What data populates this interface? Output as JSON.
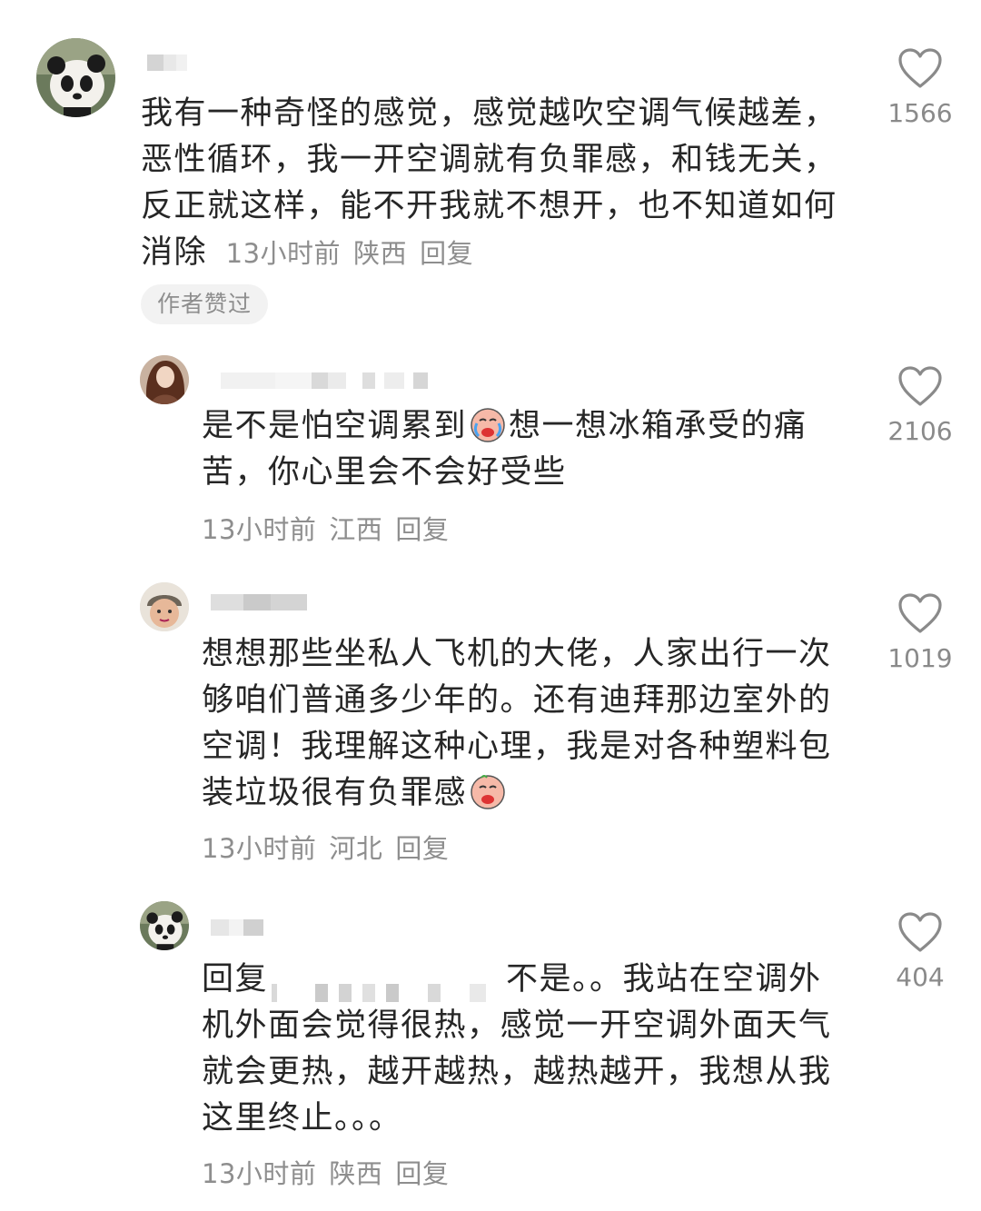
{
  "comments": [
    {
      "text": "我有一种奇怪的感觉，感觉越吹空调气候越差，恶性循环，我一开空调就有负罪感，和钱无关，反正就这样，能不开我就不想开，也不知道如何消除",
      "time": "13小时前",
      "location": "陕西",
      "reply_label": "回复",
      "likes": "1566",
      "badge": "作者赞过",
      "avatar_icon": "panda-avatar-icon"
    },
    {
      "text_before_emoji": "是不是怕空调累到",
      "text_after_emoji": "想一想冰箱承受的痛苦，你心里会不会好受些",
      "emoji": "crying-emoji",
      "time": "13小时前",
      "location": "江西",
      "reply_label": "回复",
      "likes": "2106",
      "avatar_icon": "woman-avatar-icon"
    },
    {
      "text": "想想那些坐私人飞机的大佬，人家出行一次够咱们普通多少年的。还有迪拜那边室外的空调！我理解这种心理，我是对各种塑料包装垃圾很有负罪感",
      "emoji": "crying-emoji",
      "time": "13小时前",
      "location": "河北",
      "reply_label": "回复",
      "likes": "1019",
      "avatar_icon": "child-avatar-icon"
    },
    {
      "reply_prefix": "回复",
      "text": "不是。。我站在空调外机外面会觉得很热，感觉一开空调外面天气就会更热，越开越热，越热越开，我想从我这里终止。。。",
      "time": "13小时前",
      "location": "陕西",
      "reply_label": "回复",
      "likes": "404",
      "avatar_icon": "panda-avatar-icon"
    }
  ]
}
